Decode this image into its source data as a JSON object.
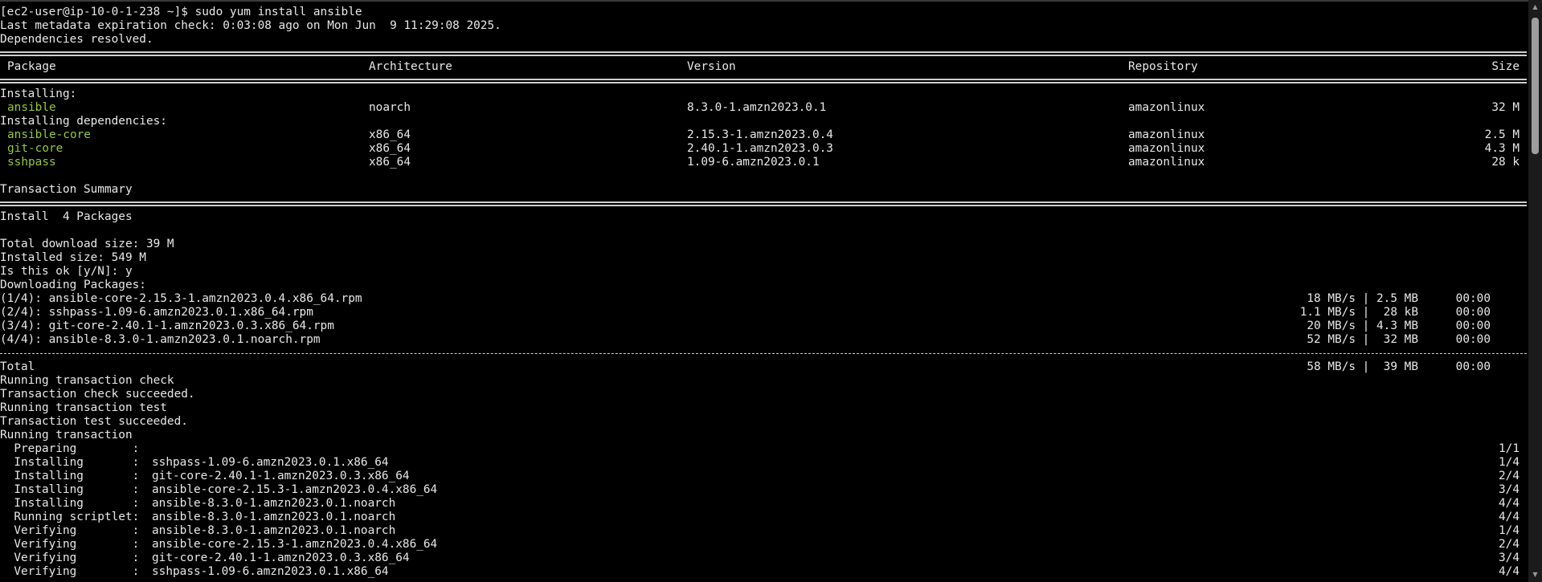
{
  "terminal": {
    "prompt": "[ec2-user@ip-10-0-1-238 ~]$ sudo yum install ansible",
    "meta": "Last metadata expiration check: 0:03:08 ago on Mon Jun  9 11:29:08 2025.",
    "deps": "Dependencies resolved.",
    "headers": {
      "package": "Package",
      "arch": "Architecture",
      "version": "Version",
      "repo": "Repository",
      "size": "Size"
    },
    "installing_label": "Installing:",
    "installing": [
      {
        "name": "ansible",
        "arch": "noarch",
        "version": "8.3.0-1.amzn2023.0.1",
        "repo": "amazonlinux",
        "size": "32 M"
      }
    ],
    "deps_label": "Installing dependencies:",
    "dependencies": [
      {
        "name": "ansible-core",
        "arch": "x86_64",
        "version": "2.15.3-1.amzn2023.0.4",
        "repo": "amazonlinux",
        "size": "2.5 M"
      },
      {
        "name": "git-core",
        "arch": "x86_64",
        "version": "2.40.1-1.amzn2023.0.3",
        "repo": "amazonlinux",
        "size": "4.3 M"
      },
      {
        "name": "sshpass",
        "arch": "x86_64",
        "version": "1.09-6.amzn2023.0.1",
        "repo": "amazonlinux",
        "size": "28 k"
      }
    ],
    "summary_title": "Transaction Summary",
    "install_count": "Install  4 Packages",
    "total_download": "Total download size: 39 M",
    "installed_size": "Installed size: 549 M",
    "confirm": "Is this ok [y/N]: y",
    "downloading": "Downloading Packages:",
    "downloads": [
      {
        "file": "(1/4): ansible-core-2.15.3-1.amzn2023.0.4.x86_64.rpm",
        "speed": "18 MB/s | 2.5 MB",
        "time": "00:00"
      },
      {
        "file": "(2/4): sshpass-1.09-6.amzn2023.0.1.x86_64.rpm",
        "speed": "1.1 MB/s |  28 kB",
        "time": "00:00"
      },
      {
        "file": "(3/4): git-core-2.40.1-1.amzn2023.0.3.x86_64.rpm",
        "speed": "20 MB/s | 4.3 MB",
        "time": "00:00"
      },
      {
        "file": "(4/4): ansible-8.3.0-1.amzn2023.0.1.noarch.rpm",
        "speed": "52 MB/s |  32 MB",
        "time": "00:00"
      }
    ],
    "total": {
      "label": "Total",
      "speed": "58 MB/s |  39 MB",
      "time": "00:00"
    },
    "checks": [
      "Running transaction check",
      "Transaction check succeeded.",
      "Running transaction test",
      "Transaction test succeeded.",
      "Running transaction"
    ],
    "steps": [
      {
        "action": "  Preparing        :",
        "pkg": "",
        "count": "1/1"
      },
      {
        "action": "  Installing       :",
        "pkg": "sshpass-1.09-6.amzn2023.0.1.x86_64",
        "count": "1/4"
      },
      {
        "action": "  Installing       :",
        "pkg": "git-core-2.40.1-1.amzn2023.0.3.x86_64",
        "count": "2/4"
      },
      {
        "action": "  Installing       :",
        "pkg": "ansible-core-2.15.3-1.amzn2023.0.4.x86_64",
        "count": "3/4"
      },
      {
        "action": "  Installing       :",
        "pkg": "ansible-8.3.0-1.amzn2023.0.1.noarch",
        "count": "4/4"
      },
      {
        "action": "  Running scriptlet:",
        "pkg": "ansible-8.3.0-1.amzn2023.0.1.noarch",
        "count": "4/4"
      },
      {
        "action": "  Verifying        :",
        "pkg": "ansible-8.3.0-1.amzn2023.0.1.noarch",
        "count": "1/4"
      },
      {
        "action": "  Verifying        :",
        "pkg": "ansible-core-2.15.3-1.amzn2023.0.4.x86_64",
        "count": "2/4"
      },
      {
        "action": "  Verifying        :",
        "pkg": "git-core-2.40.1-1.amzn2023.0.3.x86_64",
        "count": "3/4"
      },
      {
        "action": "  Verifying        :",
        "pkg": "sshpass-1.09-6.amzn2023.0.1.x86_64",
        "count": "4/4"
      }
    ]
  },
  "scrollbar": {
    "up_icon": "arrow-up-icon",
    "down_icon": "arrow-down-icon",
    "position": 0.0
  }
}
